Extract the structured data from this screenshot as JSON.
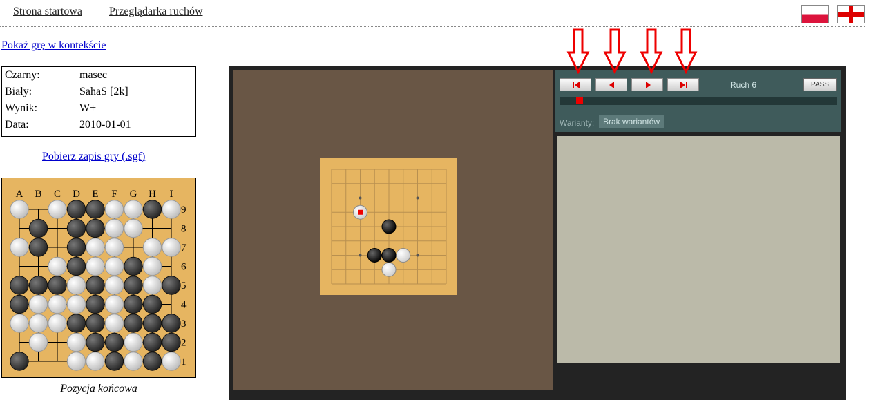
{
  "nav": {
    "home": "Strona startowa",
    "viewer": "Przeglądarka ruchów"
  },
  "lang_flags": [
    "pl",
    "en"
  ],
  "context_link": "Pokaż grę w kontekście",
  "game_info": [
    {
      "label": "Czarny:",
      "value": "masec"
    },
    {
      "label": "Biały:",
      "value": "SahaS [2k]"
    },
    {
      "label": "Wynik:",
      "value": "W+"
    },
    {
      "label": "Data:",
      "value": "2010-01-01"
    }
  ],
  "download_sgf": "Pobierz zapis gry (.sgf)",
  "final_position": {
    "caption": "Pozycja końcowa",
    "columns": [
      "A",
      "B",
      "C",
      "D",
      "E",
      "F",
      "G",
      "H",
      "I"
    ],
    "rows": [
      "9",
      "8",
      "7",
      "6",
      "5",
      "4",
      "3",
      "2",
      "1"
    ],
    "board": [
      "W.WBBWWBW",
      ".B.BBWW..",
      "WB.BWW.WW",
      "..WBWWBW.",
      "BBBWBWBWB",
      "BWWWBWBB.",
      "WWWBBWBBB",
      ".W.WBBWBB",
      "B..WWBWBW"
    ]
  },
  "player": {
    "move_label": "Ruch 6",
    "pass_label": "PASS",
    "variations_label": "Warianty:",
    "variations_value": "Brak wariantów",
    "nav_buttons": [
      "first",
      "prev",
      "next",
      "last"
    ],
    "move_number": 6,
    "board_position": [
      "W.....",
      "...B..",
      ".......",
      "..BBW.",
      "...W.."
    ],
    "stones": [
      {
        "color": "W",
        "col": 3,
        "row": 4,
        "last": true
      },
      {
        "color": "B",
        "col": 5,
        "row": 5
      },
      {
        "color": "B",
        "col": 4,
        "row": 7
      },
      {
        "color": "B",
        "col": 5,
        "row": 7
      },
      {
        "color": "W",
        "col": 6,
        "row": 7
      },
      {
        "color": "W",
        "col": 5,
        "row": 8
      }
    ]
  },
  "colors": {
    "board": "#e6b561",
    "goban_bg": "#695645",
    "panel": "#3f5b5b",
    "comment": "#bbbaa9",
    "arrow": "#e00000"
  }
}
